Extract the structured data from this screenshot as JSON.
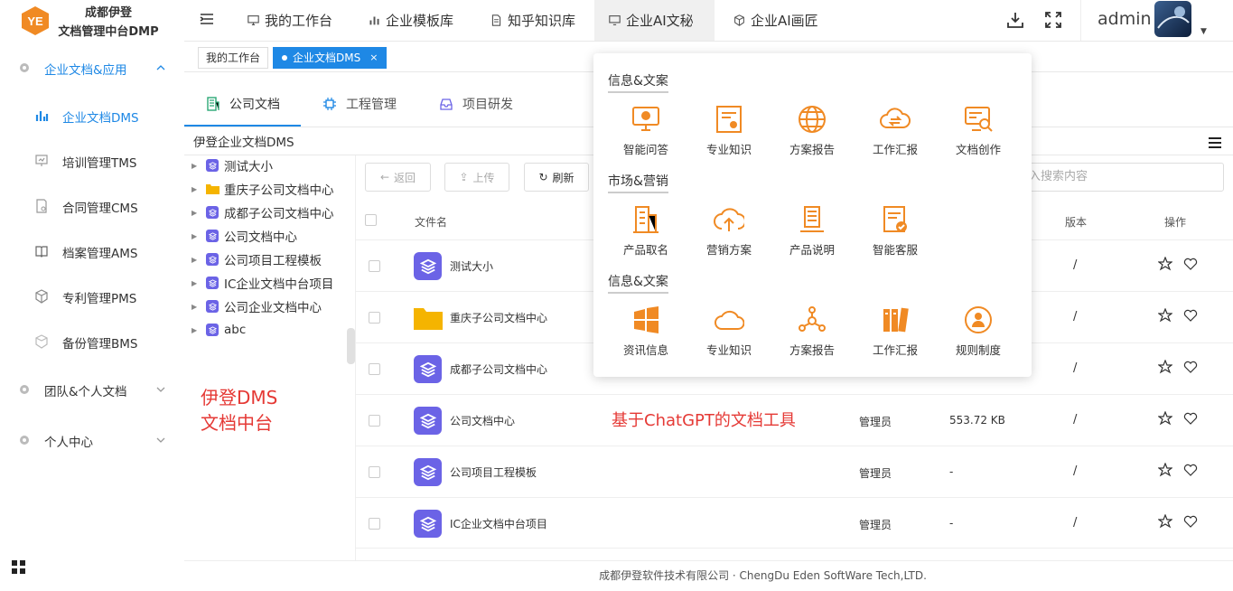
{
  "logo": {
    "line1": "成都伊登",
    "line2": "文档管理中台DMP"
  },
  "nav": [
    {
      "label": "我的工作台",
      "icon": "monitor-icon"
    },
    {
      "label": "企业模板库",
      "icon": "bar-chart-icon"
    },
    {
      "label": "知乎知识库",
      "icon": "document-icon"
    },
    {
      "label": "企业AI文秘",
      "icon": "desktop-icon",
      "active": true
    },
    {
      "label": "企业AI画匠",
      "icon": "cube-icon"
    }
  ],
  "user": {
    "name": "admin"
  },
  "sidebar": {
    "groups": [
      {
        "label": "企业文档&应用",
        "icon": "gear-icon",
        "expanded": true
      },
      {
        "label": "团队&个人文档",
        "icon": "gear-icon",
        "expanded": false
      },
      {
        "label": "个人中心",
        "icon": "gear-icon",
        "expanded": false
      }
    ],
    "items": [
      {
        "label": "企业文档DMS",
        "icon": "bar-chart-icon",
        "active": true
      },
      {
        "label": "培训管理TMS",
        "icon": "presentation-icon"
      },
      {
        "label": "合同管理CMS",
        "icon": "contract-icon"
      },
      {
        "label": "档案管理AMS",
        "icon": "book-icon"
      },
      {
        "label": "专利管理PMS",
        "icon": "cube-icon"
      },
      {
        "label": "备份管理BMS",
        "icon": "backup-icon"
      }
    ]
  },
  "tabs": {
    "home": "我的工作台",
    "current": "企业文档DMS",
    "close": "×"
  },
  "content_tabs": [
    {
      "label": "公司文档",
      "icon": "building-icon",
      "active": true
    },
    {
      "label": "工程管理",
      "icon": "chip-icon"
    },
    {
      "label": "项目研发",
      "icon": "inbox-icon"
    }
  ],
  "breadcrumb": "伊登企业文档DMS",
  "tree": [
    {
      "label": "测试大小",
      "type": "space"
    },
    {
      "label": "重庆子公司文档中心",
      "type": "folder"
    },
    {
      "label": "成都子公司文档中心",
      "type": "space"
    },
    {
      "label": "公司文档中心",
      "type": "space"
    },
    {
      "label": "公司项目工程模板",
      "type": "space"
    },
    {
      "label": "IC企业文档中台项目",
      "type": "space"
    },
    {
      "label": "公司企业文档中心",
      "type": "space"
    },
    {
      "label": "abc",
      "type": "space"
    }
  ],
  "annotation_left": {
    "line1": "伊登DMS",
    "line2": "文档中台"
  },
  "annotation_center": "基于ChatGPT的文档工具",
  "toolbar": {
    "back": "返回",
    "upload": "上传",
    "refresh": "刷新",
    "search_placeholder": "入搜索内容"
  },
  "table": {
    "headers": {
      "name": "文件名",
      "version": "版本",
      "actions": "操作"
    },
    "rows": [
      {
        "name": "测试大小",
        "type": "space",
        "owner": "",
        "size": "",
        "version": "/"
      },
      {
        "name": "重庆子公司文档中心",
        "type": "folder",
        "owner": "",
        "size": "",
        "version": "/"
      },
      {
        "name": "成都子公司文档中心",
        "type": "space",
        "owner": "",
        "size": "",
        "version": "/"
      },
      {
        "name": "公司文档中心",
        "type": "space",
        "owner": "管理员",
        "size": "553.72 KB",
        "version": "/"
      },
      {
        "name": "公司项目工程模板",
        "type": "space",
        "owner": "管理员",
        "size": "-",
        "version": "/"
      },
      {
        "name": "IC企业文档中台项目",
        "type": "space",
        "owner": "管理员",
        "size": "-",
        "version": "/"
      }
    ]
  },
  "dropdown": {
    "sections": [
      {
        "title": "信息&文案",
        "items": [
          {
            "label": "智能问答",
            "icon": "qa-monitor-icon"
          },
          {
            "label": "专业知识",
            "icon": "certificate-icon"
          },
          {
            "label": "方案报告",
            "icon": "globe-icon"
          },
          {
            "label": "工作汇报",
            "icon": "cloud-sync-icon"
          },
          {
            "label": "文档创作",
            "icon": "search-monitor-icon"
          }
        ]
      },
      {
        "title": "市场&营销",
        "items": [
          {
            "label": "产品取名",
            "icon": "building-icon"
          },
          {
            "label": "营销方案",
            "icon": "cloud-upload-icon"
          },
          {
            "label": "产品说明",
            "icon": "server-icon"
          },
          {
            "label": "智能客服",
            "icon": "checklist-icon"
          }
        ]
      },
      {
        "title": "信息&文案",
        "items": [
          {
            "label": "资讯信息",
            "icon": "windows-icon"
          },
          {
            "label": "专业知识",
            "icon": "cloud-icon"
          },
          {
            "label": "方案报告",
            "icon": "network-icon"
          },
          {
            "label": "工作汇报",
            "icon": "books-icon"
          },
          {
            "label": "规则制度",
            "icon": "user-badge-icon"
          }
        ]
      }
    ]
  },
  "footer": "成都伊登软件技术有限公司 · ChengDu Eden SoftWare Tech,LTD.",
  "colors": {
    "accent": "#1e88e5",
    "icon_orange": "#f08a24",
    "space_purple": "#6b63e6",
    "annotation_red": "#e53935"
  }
}
